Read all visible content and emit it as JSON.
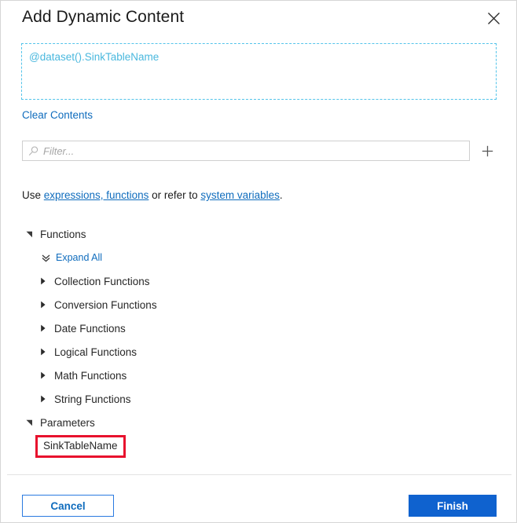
{
  "dialog": {
    "title": "Add Dynamic Content",
    "close_icon": "close-icon"
  },
  "expression": {
    "value": "@dataset().SinkTableName",
    "clear_label": "Clear Contents",
    "border_color": "#53c4ea",
    "text_color": "#4ab8de"
  },
  "filter": {
    "placeholder": "Filter...",
    "value": "",
    "search_icon": "search-icon",
    "add_icon": "plus-icon"
  },
  "help": {
    "prefix": "Use ",
    "link1": "expressions, functions",
    "middle": " or refer to ",
    "link2": "system variables",
    "suffix": "."
  },
  "tree": {
    "functions": {
      "label": "Functions",
      "expanded": true,
      "expand_all_label": "Expand All",
      "children": [
        {
          "label": "Collection Functions"
        },
        {
          "label": "Conversion Functions"
        },
        {
          "label": "Date Functions"
        },
        {
          "label": "Logical Functions"
        },
        {
          "label": "Math Functions"
        },
        {
          "label": "String Functions"
        }
      ]
    },
    "parameters": {
      "label": "Parameters",
      "expanded": true,
      "children": [
        {
          "label": "SinkTableName",
          "highlighted": true,
          "highlight_color": "#e8112d"
        }
      ]
    }
  },
  "footer": {
    "cancel_label": "Cancel",
    "finish_label": "Finish",
    "finish_color": "#0f62cf"
  }
}
